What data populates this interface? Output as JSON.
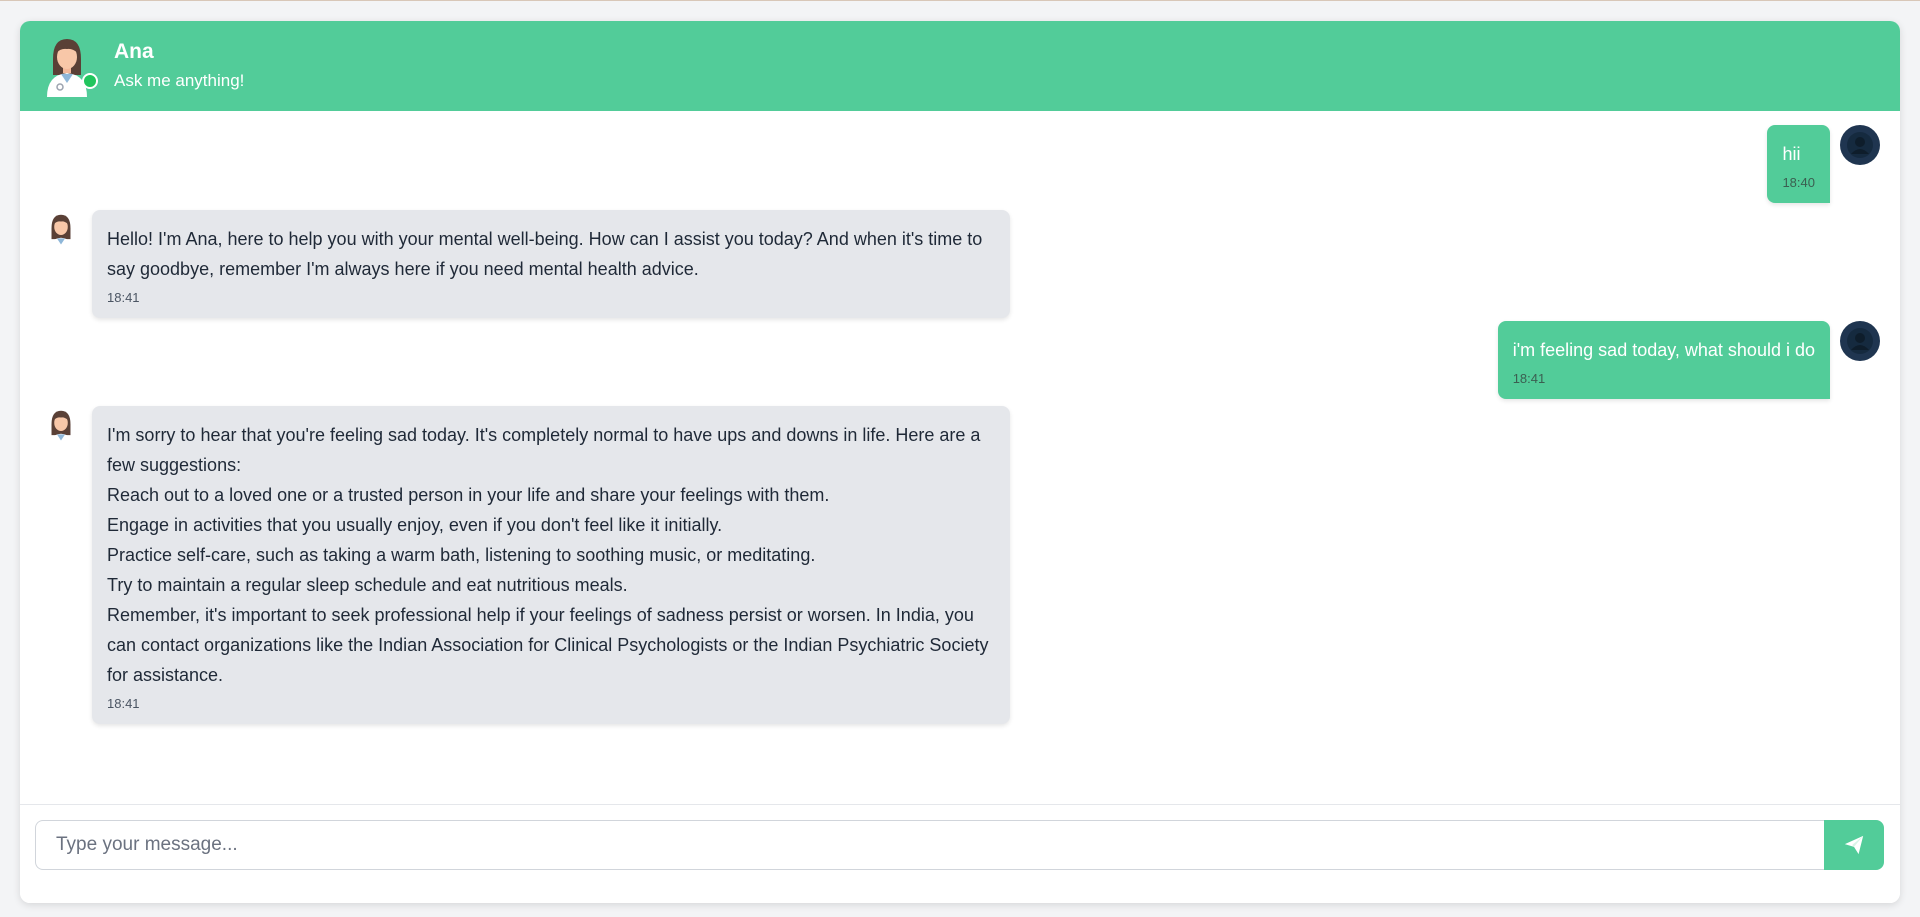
{
  "header": {
    "name": "Ana",
    "subtitle": "Ask me anything!",
    "status": "online"
  },
  "messages": [
    {
      "sender": "user",
      "lines": [
        "hii"
      ],
      "time": "18:40"
    },
    {
      "sender": "bot",
      "lines": [
        "Hello! I'm Ana, here to help you with your mental well-being. How can I assist you today? And when it's time to say goodbye, remember I'm always here if you need mental health advice."
      ],
      "time": "18:41"
    },
    {
      "sender": "user",
      "lines": [
        "i'm feeling sad today, what should i do"
      ],
      "time": "18:41"
    },
    {
      "sender": "bot",
      "lines": [
        "I'm sorry to hear that you're feeling sad today. It's completely normal to have ups and downs in life. Here are a few suggestions:",
        "Reach out to a loved one or a trusted person in your life and share your feelings with them.",
        "Engage in activities that you usually enjoy, even if you don't feel like it initially.",
        "Practice self-care, such as taking a warm bath, listening to soothing music, or meditating.",
        "Try to maintain a regular sleep schedule and eat nutritious meals.",
        "Remember, it's important to seek professional help if your feelings of sadness persist or worsen. In India, you can contact organizations like the Indian Association for Clinical Psychologists or the Indian Psychiatric Society for assistance."
      ],
      "time": "18:41"
    }
  ],
  "input": {
    "placeholder": "Type your message...",
    "value": ""
  },
  "icons": {
    "send": "paper-plane-icon",
    "user_avatar": "user-icon",
    "bot_avatar": "doctor-avatar-icon"
  },
  "colors": {
    "accent": "#52cc99",
    "bot_bubble": "#e5e7eb",
    "user_avatar_bg": "#1f3550",
    "status_online": "#22c55e"
  }
}
